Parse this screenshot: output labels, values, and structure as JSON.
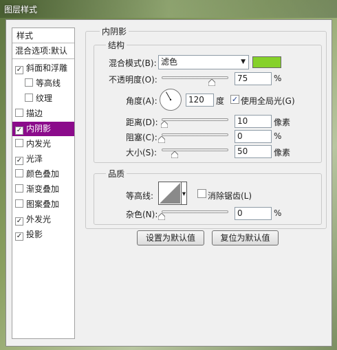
{
  "window": {
    "title": "图层样式"
  },
  "sidebar": {
    "header": "样式",
    "blend_default": "混合选项:默认",
    "items": [
      {
        "label": "斜面和浮雕",
        "checked": true
      },
      {
        "label": "等高线",
        "checked": false
      },
      {
        "label": "纹理",
        "checked": false
      },
      {
        "label": "描边",
        "checked": false
      },
      {
        "label": "内阴影",
        "checked": true,
        "selected": true
      },
      {
        "label": "内发光",
        "checked": false
      },
      {
        "label": "光泽",
        "checked": true
      },
      {
        "label": "颜色叠加",
        "checked": false
      },
      {
        "label": "渐变叠加",
        "checked": false
      },
      {
        "label": "图案叠加",
        "checked": false
      },
      {
        "label": "外发光",
        "checked": true
      },
      {
        "label": "投影",
        "checked": true
      }
    ]
  },
  "panel": {
    "title": "内阴影",
    "structure": {
      "title": "结构",
      "blend_mode_label": "混合模式(B):",
      "blend_mode_value": "滤色",
      "blend_color": "#86d12a",
      "opacity_label": "不透明度(O):",
      "opacity_value": "75",
      "opacity_unit": "%",
      "opacity_fraction": 0.75,
      "angle_label": "角度(A):",
      "angle_value": "120",
      "angle_unit": "度",
      "global_light_label": "使用全局光(G)",
      "global_light_checked": true,
      "distance_label": "距离(D):",
      "distance_value": "10",
      "distance_unit": "像素",
      "distance_fraction": 0.04,
      "choke_label": "阻塞(C):",
      "choke_value": "0",
      "choke_unit": "%",
      "choke_fraction": 0.0,
      "size_label": "大小(S):",
      "size_value": "50",
      "size_unit": "像素",
      "size_fraction": 0.2
    },
    "quality": {
      "title": "品质",
      "contour_label": "等高线:",
      "antialias_label": "消除锯齿(L)",
      "antialias_checked": false,
      "noise_label": "杂色(N):",
      "noise_value": "0",
      "noise_unit": "%",
      "noise_fraction": 0.0
    },
    "buttons": {
      "set_default": "设置为默认值",
      "reset_default": "复位为默认值"
    }
  }
}
